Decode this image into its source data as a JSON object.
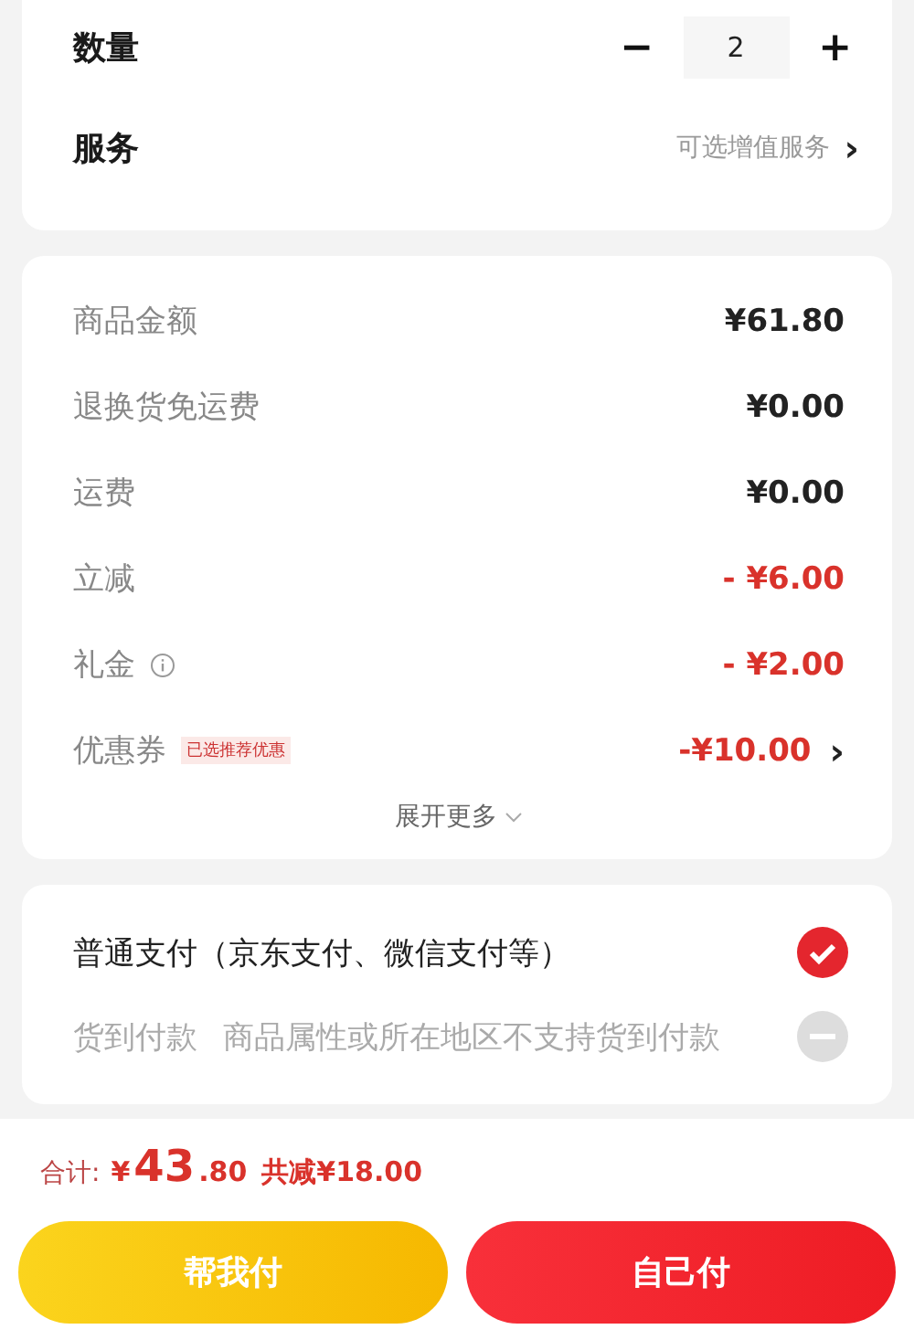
{
  "order_card": {
    "quantity_label": "数量",
    "minus": "−",
    "quantity": "2",
    "plus": "+",
    "service_label": "服务",
    "service_hint": "可选增值服务",
    "service_chevron": "›"
  },
  "fees": {
    "rows": [
      {
        "label": "商品金额",
        "value": "¥61.80",
        "discount": false,
        "info": false,
        "chevron": false
      },
      {
        "label": "退换货免运费",
        "value": "¥0.00",
        "discount": false,
        "info": false,
        "chevron": false
      },
      {
        "label": "运费",
        "value": "¥0.00",
        "discount": false,
        "info": false,
        "chevron": false
      },
      {
        "label": "立减",
        "value": "- ¥6.00",
        "discount": true,
        "info": false,
        "chevron": false
      },
      {
        "label": "礼金",
        "value": "- ¥2.00",
        "discount": true,
        "info": true,
        "chevron": false
      },
      {
        "label": "优惠券",
        "tag": "已选推荐优惠",
        "value": "-¥10.00",
        "discount": true,
        "info": false,
        "chevron": true,
        "chevron_text": "›"
      }
    ],
    "expand": "展开更多"
  },
  "payment_options": [
    {
      "label": "普通支付（京东支付、微信支付等）",
      "selected": true,
      "disabled": false
    },
    {
      "label": "货到付款",
      "note": "商品属性或所在地区不支持货到付款",
      "selected": false,
      "disabled": true
    }
  ],
  "footer": {
    "total_label": "合计:",
    "currency": "¥",
    "total_int": "43",
    "total_dec": ".80",
    "saved": "共减¥18.00",
    "buttons": [
      {
        "label": "帮我付",
        "kind": "secondary"
      },
      {
        "label": "自己付",
        "kind": "primary"
      }
    ]
  }
}
